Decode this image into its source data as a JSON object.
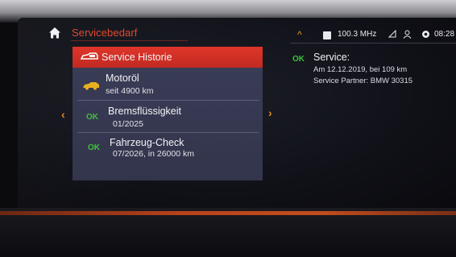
{
  "header": {
    "title": "Servicebedarf"
  },
  "list": {
    "items": [
      {
        "title": "Service Historie",
        "subtitle": "",
        "status": "",
        "icon": "service-history-icon",
        "selected": true
      },
      {
        "title": "Motoröl",
        "subtitle": "seit 4900 km",
        "status": "",
        "icon": "oil-can-icon",
        "selected": false
      },
      {
        "title": "Bremsflüssigkeit",
        "subtitle": "01/2025",
        "status": "OK",
        "icon": "",
        "selected": false
      },
      {
        "title": "Fahrzeug-Check",
        "subtitle": "07/2026, in 26000 km",
        "status": "OK",
        "icon": "",
        "selected": false
      }
    ]
  },
  "status_bar": {
    "frequency": "100.3 MHz",
    "time": "08:28"
  },
  "detail": {
    "status": "OK",
    "title": "Service:",
    "line1": "Am 12.12.2019, bei 109 km",
    "line2": "Service Partner: BMW 30315"
  },
  "colors": {
    "accent_red": "#e14a2f",
    "highlight": "#d4312a",
    "ok_green": "#3cc23c",
    "warning_amber": "#e8b020",
    "panel": "#373a52"
  }
}
